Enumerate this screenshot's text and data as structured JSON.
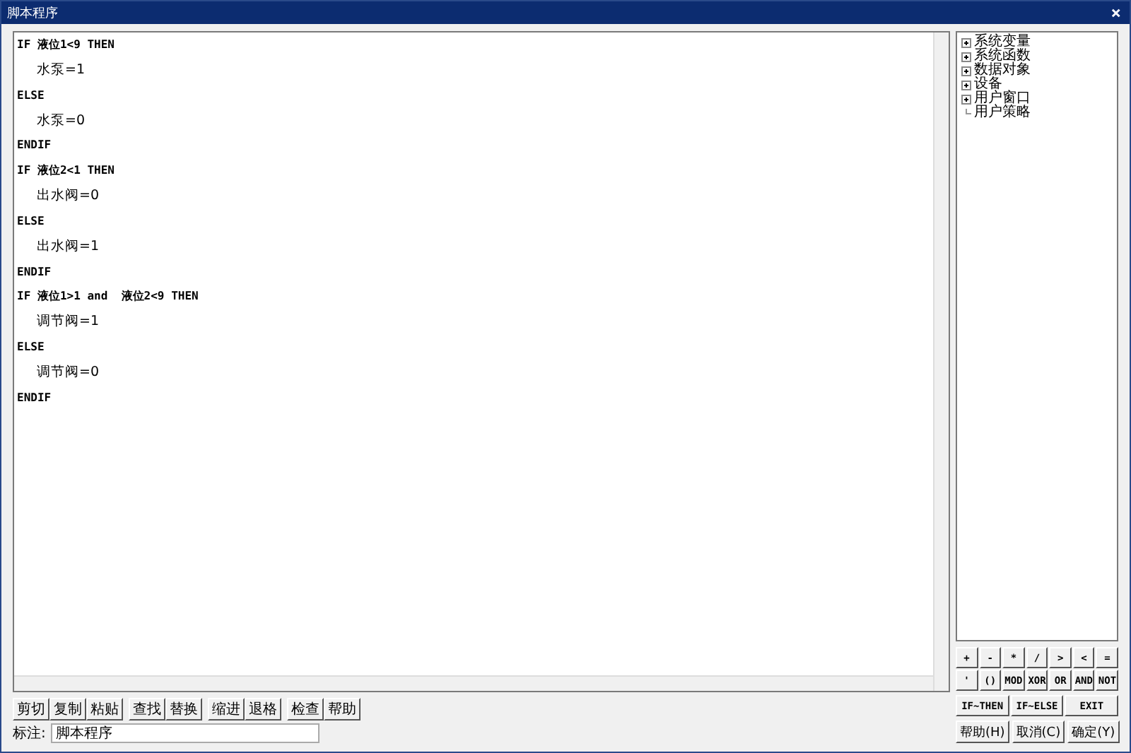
{
  "window": {
    "title": "脚本程序",
    "close": "×"
  },
  "editor": {
    "lines": [
      {
        "text": "IF 液位1<9 THEN",
        "kind": "control"
      },
      {
        "text": "水泵=1",
        "kind": "statement"
      },
      {
        "text": "ELSE",
        "kind": "control"
      },
      {
        "text": "水泵=0",
        "kind": "statement"
      },
      {
        "text": "ENDIF",
        "kind": "control"
      },
      {
        "text": "IF 液位2<1 THEN",
        "kind": "control"
      },
      {
        "text": "出水阀=0",
        "kind": "statement"
      },
      {
        "text": "ELSE",
        "kind": "control"
      },
      {
        "text": "出水阀=1",
        "kind": "statement"
      },
      {
        "text": "ENDIF",
        "kind": "control"
      },
      {
        "text": "IF 液位1>1 and  液位2<9 THEN",
        "kind": "control"
      },
      {
        "text": "调节阀=1",
        "kind": "statement"
      },
      {
        "text": "ELSE",
        "kind": "control"
      },
      {
        "text": "调节阀=0",
        "kind": "statement"
      },
      {
        "text": "ENDIF",
        "kind": "control"
      }
    ]
  },
  "edit_buttons": [
    [
      "剪切",
      "复制",
      "粘贴"
    ],
    [
      "查找",
      "替换"
    ],
    [
      "缩进",
      "退格"
    ],
    [
      "检查",
      "帮助"
    ]
  ],
  "note": {
    "label": "标注:",
    "value": "脚本程序"
  },
  "tree": {
    "items": [
      {
        "label": "系统变量",
        "kind": "group",
        "expanded": false
      },
      {
        "label": "系统函数",
        "kind": "group",
        "expanded": false
      },
      {
        "label": "数据对象",
        "kind": "group",
        "expanded": false
      },
      {
        "label": "设备",
        "kind": "group",
        "expanded": false
      },
      {
        "label": "用户窗口",
        "kind": "group",
        "expanded": false
      },
      {
        "label": "用户策略",
        "kind": "leaf"
      }
    ]
  },
  "keypad": {
    "rows": [
      [
        "+",
        "-",
        "*",
        "/",
        ">",
        "<",
        "="
      ],
      [
        "'",
        "()",
        "MOD",
        "XOR",
        "OR",
        "AND",
        "NOT"
      ]
    ],
    "command_keys": [
      "IF~THEN",
      "IF~ELSE",
      "EXIT"
    ]
  },
  "dialog_buttons": [
    "帮助(H)",
    "取消(C)",
    "确定(Y)"
  ]
}
